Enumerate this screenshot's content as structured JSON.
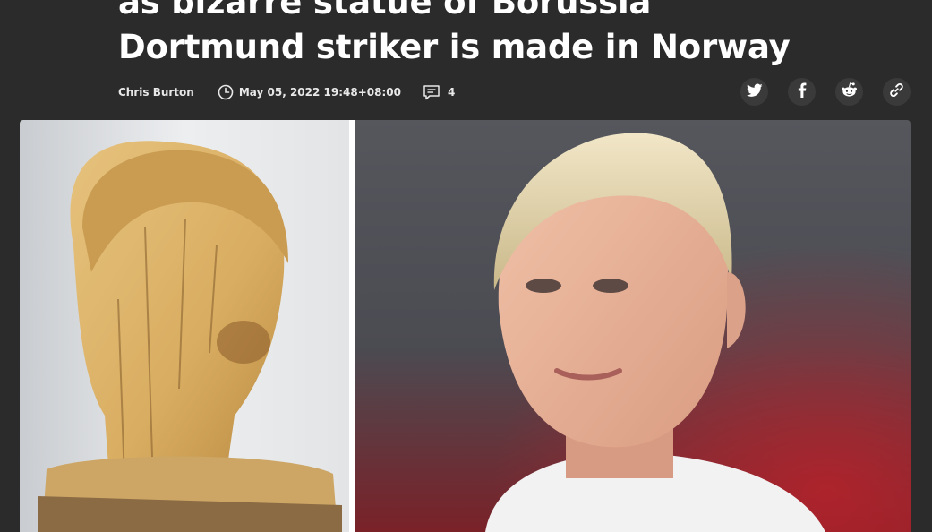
{
  "article": {
    "title_line1": "as bizarre statue of Borussia",
    "title_line2": "Dortmund striker is made in Norway",
    "author": "Chris Burton",
    "date": "May 05, 2022 19:48+08:00",
    "comment_count": "4"
  },
  "icons": {
    "date": "clock-icon",
    "comments": "comment-icon",
    "share": [
      "twitter-icon",
      "facebook-icon",
      "reddit-icon",
      "link-icon"
    ]
  },
  "colors": {
    "background": "#2b2b2b",
    "text": "#ffffff",
    "share_button_bg": "#3a3a3a"
  }
}
